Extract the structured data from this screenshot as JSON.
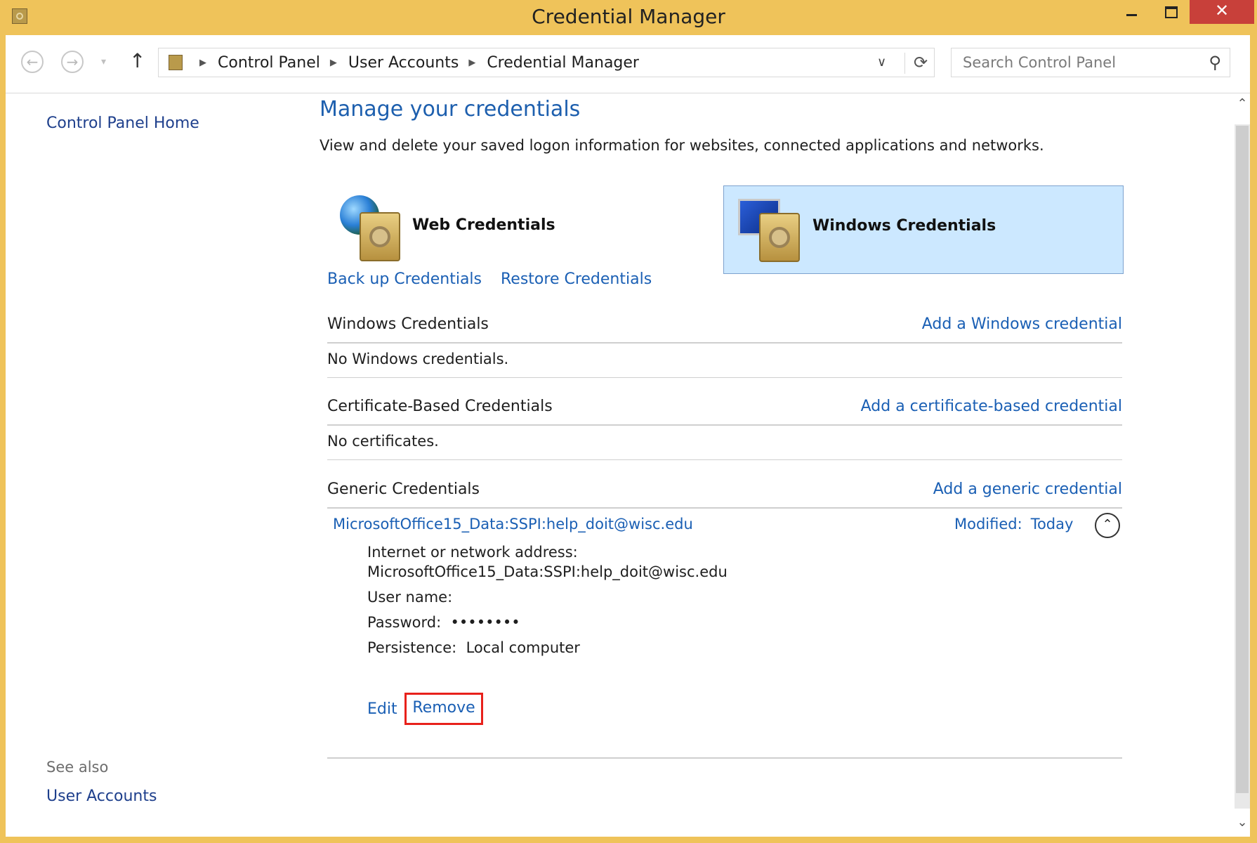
{
  "window": {
    "title": "Credential Manager",
    "close_glyph": "✕",
    "accent_color": "#efc35a"
  },
  "navigation": {
    "back_glyph": "←",
    "forward_glyph": "→",
    "history_glyph": "▾",
    "up_glyph": "↑",
    "breadcrumbs": [
      "Control Panel",
      "User Accounts",
      "Credential Manager"
    ],
    "separator_glyph": "▶",
    "dropdown_glyph": "∨",
    "refresh_glyph": "⟳",
    "search_placeholder": "Search Control Panel",
    "search_glyph": "⚲"
  },
  "sidebar": {
    "home_link": "Control Panel Home",
    "see_also_label": "See also",
    "see_also_link": "User Accounts"
  },
  "main": {
    "heading": "Manage your credentials",
    "description": "View and delete your saved logon information for websites, connected applications and networks.",
    "tiles": {
      "web": "Web Credentials",
      "windows": "Windows Credentials",
      "selected": "windows"
    },
    "actions": {
      "backup": "Back up Credentials",
      "restore": "Restore Credentials"
    },
    "sections": {
      "windows": {
        "title": "Windows Credentials",
        "add": "Add a Windows credential",
        "empty": "No Windows credentials."
      },
      "certificate": {
        "title": "Certificate-Based Credentials",
        "add": "Add a certificate-based credential",
        "empty": "No certificates."
      },
      "generic": {
        "title": "Generic Credentials",
        "add": "Add a generic credential"
      }
    },
    "generic_credential": {
      "name": "MicrosoftOffice15_Data:SSPI:help_doit@wisc.edu",
      "modified_label": "Modified:",
      "modified_value": "Today",
      "collapse_glyph": "⌃",
      "address_label": "Internet or network address:",
      "address_value": "MicrosoftOffice15_Data:SSPI:help_doit@wisc.edu",
      "username_label": "User name:",
      "password_label": "Password:",
      "password_value": "••••••••",
      "persistence_label": "Persistence:",
      "persistence_value": "Local computer",
      "edit_label": "Edit",
      "remove_label": "Remove"
    }
  },
  "scrollbar": {
    "up_glyph": "⌃",
    "down_glyph": "⌄"
  }
}
